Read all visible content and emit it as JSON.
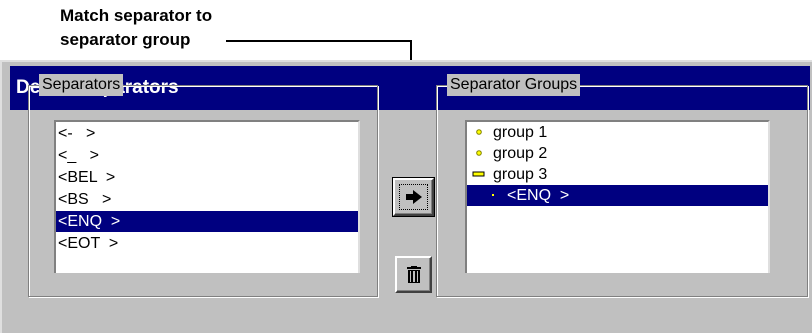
{
  "callout": {
    "line1": "Match separator to",
    "line2": "separator group"
  },
  "window": {
    "title": "Define Separators"
  },
  "separators": {
    "label": "Separators",
    "items": [
      {
        "label": "<-   >",
        "selected": false
      },
      {
        "label": "<_   >",
        "selected": false
      },
      {
        "label": "<BEL  >",
        "selected": false
      },
      {
        "label": "<BS   >",
        "selected": false
      },
      {
        "label": "<ENQ  >",
        "selected": true
      },
      {
        "label": "<EOT  >",
        "selected": false
      }
    ]
  },
  "buttons": {
    "move_icon": "arrow-right-icon",
    "delete_icon": "trash-icon"
  },
  "separator_groups": {
    "label": "Separator Groups",
    "nodes": [
      {
        "label": "group 1",
        "icon": "circle-icon",
        "level": 0,
        "selected": false
      },
      {
        "label": "group 2",
        "icon": "circle-icon",
        "level": 0,
        "selected": false
      },
      {
        "label": "group 3",
        "icon": "folder-bar-icon",
        "level": 0,
        "selected": false
      },
      {
        "label": "<ENQ  >",
        "icon": "dot-icon",
        "level": 1,
        "selected": true
      }
    ]
  }
}
